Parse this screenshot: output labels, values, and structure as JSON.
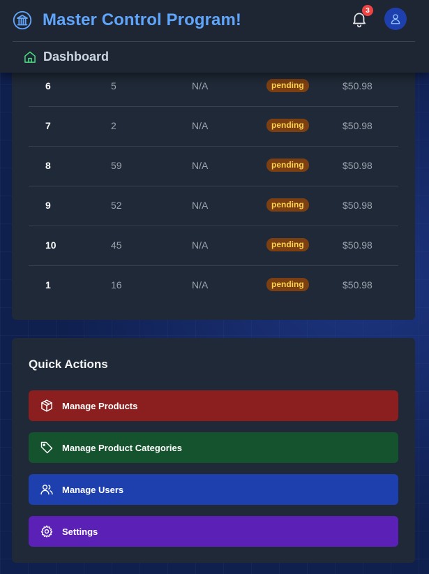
{
  "header": {
    "title": "Master Control Program!",
    "notification_count": "3",
    "breadcrumb": "Dashboard"
  },
  "orders": {
    "rows": [
      {
        "id": "6",
        "qty": "5",
        "ref": "N/A",
        "status": "pending",
        "price": "$50.98"
      },
      {
        "id": "7",
        "qty": "2",
        "ref": "N/A",
        "status": "pending",
        "price": "$50.98"
      },
      {
        "id": "8",
        "qty": "59",
        "ref": "N/A",
        "status": "pending",
        "price": "$50.98"
      },
      {
        "id": "9",
        "qty": "52",
        "ref": "N/A",
        "status": "pending",
        "price": "$50.98"
      },
      {
        "id": "10",
        "qty": "45",
        "ref": "N/A",
        "status": "pending",
        "price": "$50.98"
      },
      {
        "id": "1",
        "qty": "16",
        "ref": "N/A",
        "status": "pending",
        "price": "$50.98"
      }
    ]
  },
  "quick_actions": {
    "title": "Quick Actions",
    "buttons": [
      {
        "label": "Manage Products",
        "icon": "package-icon",
        "color": "#8b1e1e"
      },
      {
        "label": "Manage Product Categories",
        "icon": "tag-icon",
        "color": "#14532d"
      },
      {
        "label": "Manage Users",
        "icon": "users-icon",
        "color": "#1e40af"
      },
      {
        "label": "Settings",
        "icon": "gear-icon",
        "color": "#5b21b6"
      }
    ]
  },
  "colors": {
    "accent": "#60a5fa",
    "status_pending_bg": "#7c3f12",
    "status_pending_text": "#fcd34d",
    "badge": "#ef4444"
  }
}
